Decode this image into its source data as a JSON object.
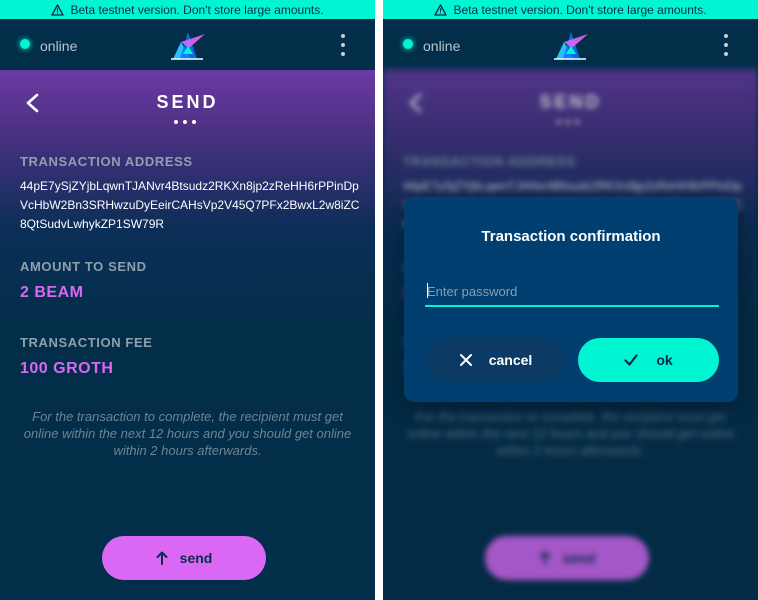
{
  "banner": {
    "text": "Beta testnet version. Don't store large amounts."
  },
  "status": {
    "text": "online"
  },
  "page": {
    "title": "SEND"
  },
  "transaction": {
    "address_label": "TRANSACTION ADDRESS",
    "address": "44pE7ySjZYjbLqwnTJANvr4Btsudz2RKXn8jp2zReHH6rPPinDpVcHbW2Bn3SRHwzuDyEeirCAHsVp2V45Q7PFx2BwxL2w8iZC8QtSudvLwhykZP1SW79R",
    "amount_label": "AMOUNT TO SEND",
    "amount": "2 BEAM",
    "fee_label": "TRANSACTION FEE",
    "fee": "100 GROTH",
    "note": "For the transaction to complete, the recipient must get online within the next 12 hours and you should get online within 2 hours afterwards."
  },
  "send_button": {
    "label": "send"
  },
  "dialog": {
    "title": "Transaction confirmation",
    "password_placeholder": "Enter password",
    "password_value": "",
    "cancel_label": "cancel",
    "ok_label": "ok"
  },
  "colors": {
    "accent_cyan": "#00f6d2",
    "accent_pink": "#da68f5",
    "background": "#032e49",
    "dialog_bg": "#003f6f"
  },
  "icons": [
    "warning-icon",
    "beam-logo",
    "more-vertical-icon",
    "chevron-left-icon",
    "arrow-up-icon",
    "close-icon",
    "check-icon"
  ]
}
